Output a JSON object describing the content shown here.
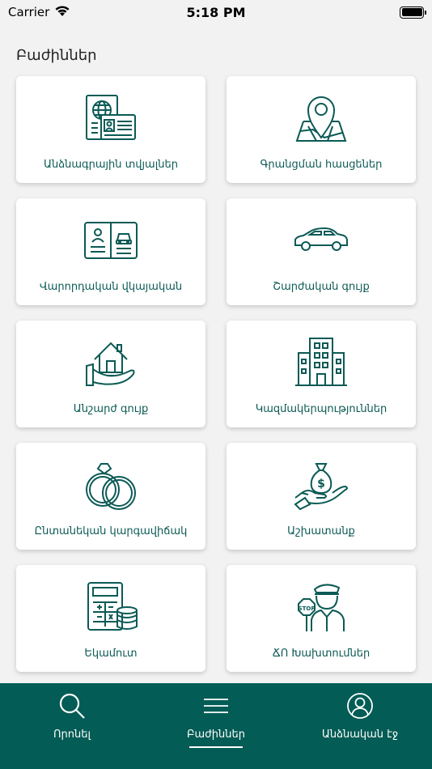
{
  "status": {
    "carrier": "Carrier",
    "time": "5:18 PM"
  },
  "section_title": "Բաժիններ",
  "cards": [
    {
      "label": "Անձնագրային տվյալներ",
      "icon": "passport-icon"
    },
    {
      "label": "Գրանցման հասցեներ",
      "icon": "map-pin-icon"
    },
    {
      "label": "Վարորդական վկայական",
      "icon": "drivers-license-icon"
    },
    {
      "label": "Շարժական գույք",
      "icon": "car-icon"
    },
    {
      "label": "Անշարժ գույք",
      "icon": "house-hand-icon"
    },
    {
      "label": "Կազմակերպություններ",
      "icon": "building-icon"
    },
    {
      "label": "Ընտանեկան կարգավիճակ",
      "icon": "rings-icon"
    },
    {
      "label": "Աշխատանք",
      "icon": "money-bag-hand-icon"
    },
    {
      "label": "Եկամուտ",
      "icon": "calculator-coins-icon"
    },
    {
      "label": "ՃՈ Խախտումներ",
      "icon": "traffic-police-icon"
    }
  ],
  "tabs": [
    {
      "label": "Որոնել",
      "icon": "search-icon",
      "active": false
    },
    {
      "label": "Բաժիններ",
      "icon": "menu-icon",
      "active": true
    },
    {
      "label": "Անձնական էջ",
      "icon": "user-icon",
      "active": false
    }
  ],
  "colors": {
    "accent": "#035c55",
    "icon": "#0b5a55",
    "background": "#f2f2f2"
  }
}
